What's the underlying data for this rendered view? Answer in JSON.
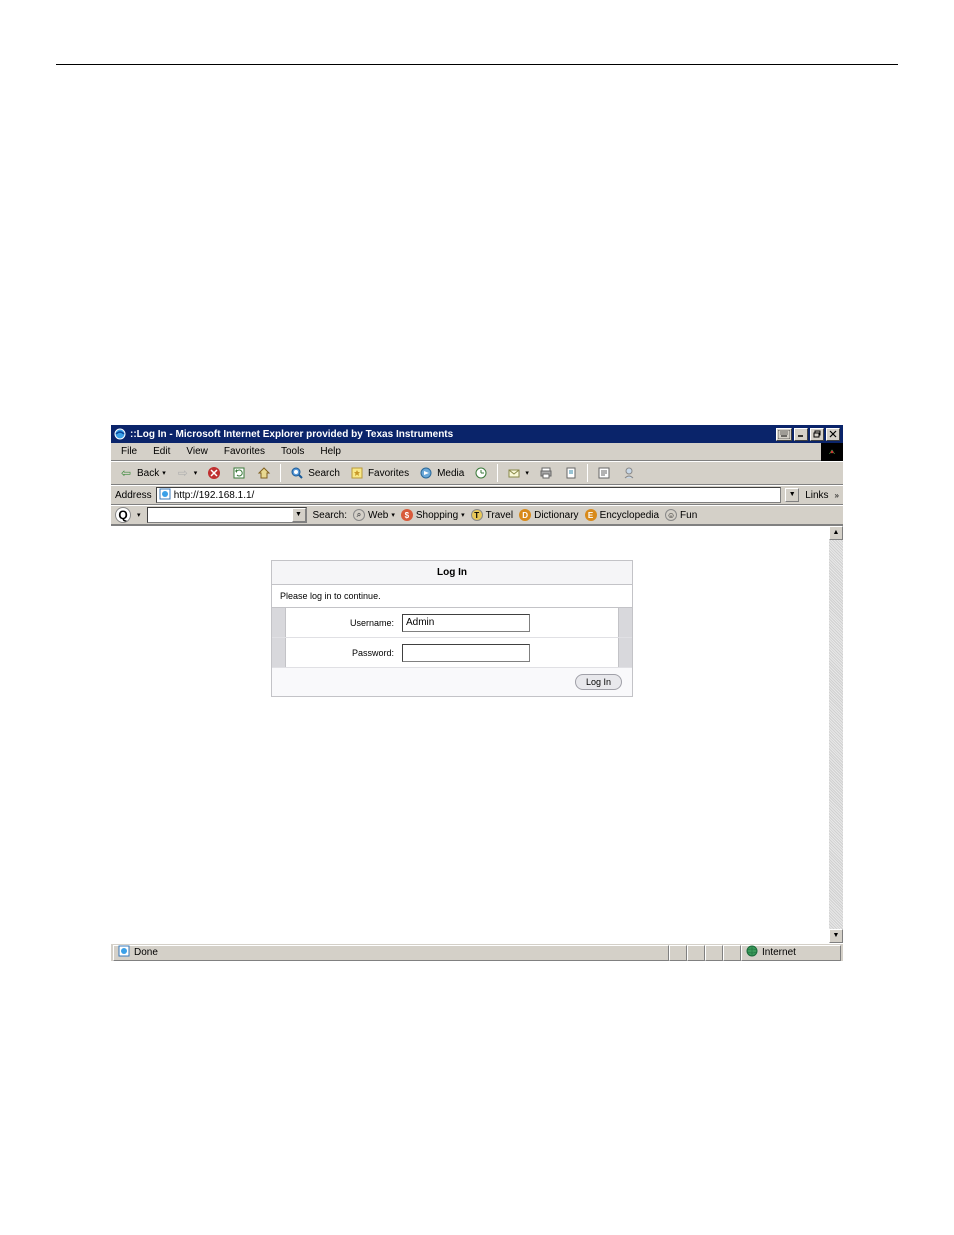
{
  "window": {
    "title": "::Log In - Microsoft Internet Explorer provided by Texas Instruments"
  },
  "menu": {
    "items": [
      "File",
      "Edit",
      "View",
      "Favorites",
      "Tools",
      "Help"
    ]
  },
  "toolbar": {
    "back": "Back",
    "search": "Search",
    "favorites": "Favorites",
    "media": "Media"
  },
  "address": {
    "label": "Address",
    "url": "http://192.168.1.1/",
    "links": "Links"
  },
  "searchbar": {
    "search_label": "Search:",
    "web": "Web",
    "shopping": "Shopping",
    "travel": "Travel",
    "dictionary": "Dictionary",
    "encyclopedia": "Encyclopedia",
    "fun": "Fun"
  },
  "login": {
    "title": "Log In",
    "message": "Please log in to continue.",
    "username_label": "Username:",
    "username_value": "Admin",
    "password_label": "Password:",
    "password_value": "",
    "button": "Log In"
  },
  "status": {
    "text": "Done",
    "zone": "Internet"
  }
}
